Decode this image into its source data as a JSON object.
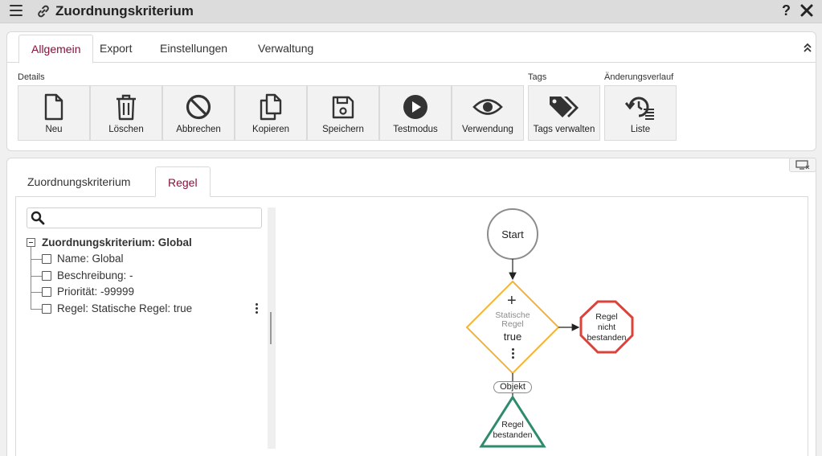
{
  "window": {
    "title": "Zuordnungskriterium",
    "help": "?"
  },
  "icons": {
    "menu": "menu-icon",
    "link": "link-icon",
    "close": "close-icon",
    "collapse": "double-chevron-up-icon",
    "search": "search-icon",
    "screen": "screen-icon"
  },
  "top_tabs": [
    {
      "label": "Allgemein",
      "active": true
    },
    {
      "label": "Export",
      "active": false
    },
    {
      "label": "Einstellungen",
      "active": false
    },
    {
      "label": "Verwaltung",
      "active": false
    }
  ],
  "groups": {
    "details": "Details",
    "tags": "Tags",
    "history": "Änderungsverlauf"
  },
  "toolbar": {
    "new": "Neu",
    "delete": "Löschen",
    "cancel": "Abbrechen",
    "copy": "Kopieren",
    "save": "Speichern",
    "test": "Testmodus",
    "usage": "Verwendung",
    "tags": "Tags verwalten",
    "list": "Liste"
  },
  "sub_tabs": [
    {
      "label": "Zuordnungskriterium",
      "active": false
    },
    {
      "label": "Regel",
      "active": true
    }
  ],
  "search": {
    "placeholder": "",
    "value": ""
  },
  "tree": {
    "root": "Zuordnungskriterium: Global",
    "items": [
      "Name: Global",
      "Beschreibung: -",
      "Priorität: -99999",
      "Regel: Statische Regel: true"
    ]
  },
  "diagram": {
    "start": "Start",
    "rule_type_line1": "Statische",
    "rule_type_line2": "Regel",
    "rule_value": "true",
    "add": "+",
    "fail_line1": "Regel",
    "fail_line2": "nicht",
    "fail_line3": "bestanden",
    "connector": "Objekt",
    "pass_line1": "Regel",
    "pass_line2": "bestanden"
  },
  "colors": {
    "accent": "#8a0f3c",
    "diamond": "#f5b335",
    "fail": "#d9433b",
    "pass": "#2e8b6e",
    "start": "#8c8c8c"
  }
}
